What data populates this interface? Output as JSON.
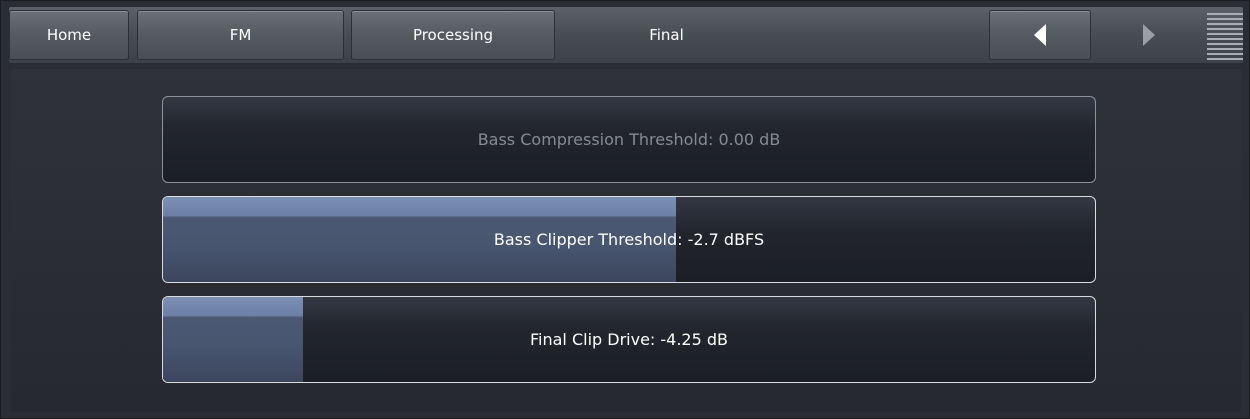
{
  "nav": {
    "tabs": [
      {
        "label": "Home"
      },
      {
        "label": "FM"
      },
      {
        "label": "Processing"
      },
      {
        "label": "Final"
      }
    ],
    "back_icon": "triangle-left-icon",
    "forward_icon": "triangle-right-icon",
    "menu_icon": "hamburger-lines-icon"
  },
  "sliders": [
    {
      "label": "Bass Compression Threshold: 0.00 dB",
      "enabled": false,
      "level": 0.0
    },
    {
      "label": "Bass Clipper Threshold: -2.7 dBFS",
      "enabled": true,
      "level": 0.55
    },
    {
      "label": "Final Clip Drive: -4.25 dB",
      "enabled": true,
      "level": 0.15
    }
  ],
  "colors": {
    "accent_fill": "#6c7fa5",
    "enabled_text": "#ffffff",
    "disabled_text": "#858b96"
  }
}
